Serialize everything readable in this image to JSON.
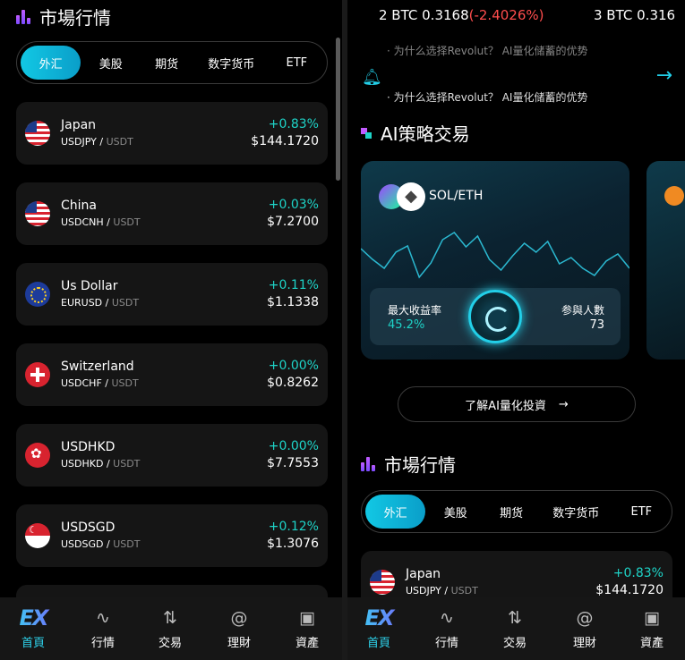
{
  "left": {
    "section_title": "市場行情",
    "tabs": [
      "外汇",
      "美股",
      "期货",
      "数字货币",
      "ETF"
    ],
    "items": [
      {
        "name": "Japan",
        "base": "USDJPY",
        "quote": "USDT",
        "change": "+0.83%",
        "price": "$144.1720",
        "flag": "us"
      },
      {
        "name": "China",
        "base": "USDCNH",
        "quote": "USDT",
        "change": "+0.03%",
        "price": "$7.2700",
        "flag": "us"
      },
      {
        "name": "Us Dollar",
        "base": "EURUSD",
        "quote": "USDT",
        "change": "+0.11%",
        "price": "$1.1338",
        "flag": "eu"
      },
      {
        "name": "Switzerland",
        "base": "USDCHF",
        "quote": "USDT",
        "change": "+0.00%",
        "price": "$0.8262",
        "flag": "ch"
      },
      {
        "name": "USDHKD",
        "base": "USDHKD",
        "quote": "USDT",
        "change": "+0.00%",
        "price": "$7.7553",
        "flag": "hk"
      },
      {
        "name": "USDSGD",
        "base": "USDSGD",
        "quote": "USDT",
        "change": "+0.12%",
        "price": "$1.3076",
        "flag": "sg"
      }
    ]
  },
  "right": {
    "ticker": {
      "left_text": "2 BTC 0.3168",
      "left_change": "(-2.4026%)",
      "right_text": "3 BTC 0.316"
    },
    "notices": [
      "· 为什么选择Revolut？ AI量化储蓄的优势",
      "· 为什么选择Revolut？ AI量化储蓄的优势"
    ],
    "ai_title": "AI策略交易",
    "ai_card": {
      "pair": "SOL/ETH",
      "max_return_label": "最大收益率",
      "max_return_value": "45.2%",
      "participants_label": "参與人數",
      "participants_value": "73",
      "sparkline": [
        52,
        40,
        30,
        48,
        55,
        20,
        36,
        62,
        70,
        54,
        66,
        40,
        28,
        44,
        58,
        48,
        60,
        35,
        42,
        30,
        22,
        38,
        46,
        30
      ]
    },
    "learn_button": "了解AI量化投資",
    "section_title": "市場行情",
    "tabs": [
      "外汇",
      "美股",
      "期货",
      "数字货币",
      "ETF"
    ],
    "item": {
      "name": "Japan",
      "base": "USDJPY",
      "quote": "USDT",
      "change": "+0.83%",
      "price": "$144.1720",
      "flag": "us"
    }
  },
  "nav": [
    {
      "label": "首頁",
      "icon": "logo-icon"
    },
    {
      "label": "行情",
      "icon": "pulse-icon"
    },
    {
      "label": "交易",
      "icon": "swap-icon"
    },
    {
      "label": "理財",
      "icon": "wealth-icon"
    },
    {
      "label": "資產",
      "icon": "wallet-icon"
    }
  ],
  "colors": {
    "accent": "#22cfe8",
    "up": "#1ed4c8",
    "down": "#ff4d4d",
    "card": "#151515"
  }
}
